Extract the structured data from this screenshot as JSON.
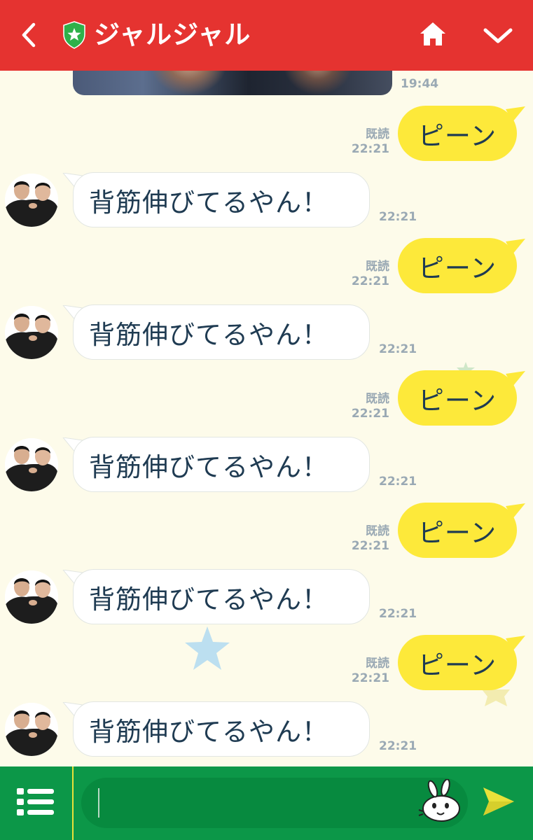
{
  "header": {
    "title": "ジャルジャル",
    "icons": [
      "back-arrow-icon",
      "shield-star-icon",
      "home-icon",
      "chevron-down-icon"
    ],
    "bg_color": "#e53330"
  },
  "chat": {
    "photo_time": "19:44",
    "rows": [
      {
        "type": "out",
        "text": "ピーン",
        "read": "既読",
        "time": "22:21"
      },
      {
        "type": "in",
        "text": "背筋伸びてるやん！",
        "time": "22:21"
      },
      {
        "type": "out",
        "text": "ピーン",
        "read": "既読",
        "time": "22:21"
      },
      {
        "type": "in",
        "text": "背筋伸びてるやん！",
        "time": "22:21"
      },
      {
        "type": "out",
        "text": "ピーン",
        "read": "既読",
        "time": "22:21"
      },
      {
        "type": "in",
        "text": "背筋伸びてるやん！",
        "time": "22:21"
      },
      {
        "type": "out",
        "text": "ピーン",
        "read": "既読",
        "time": "22:21"
      },
      {
        "type": "in",
        "text": "背筋伸びてるやん！",
        "time": "22:21"
      },
      {
        "type": "out",
        "text": "ピーン",
        "read": "既読",
        "time": "22:21"
      },
      {
        "type": "in",
        "text": "背筋伸びてるやん！",
        "time": "22:21"
      }
    ]
  },
  "input": {
    "value": "",
    "icons": [
      "menu-list-icon",
      "sticker-icon",
      "send-icon"
    ],
    "bg_color": "#0c9748"
  },
  "colors": {
    "outgoing_bubble": "#fde93a",
    "incoming_bubble": "#ffffff",
    "background": "#fdfbea",
    "text": "#1f3b52",
    "meta": "#9aa9b4"
  }
}
